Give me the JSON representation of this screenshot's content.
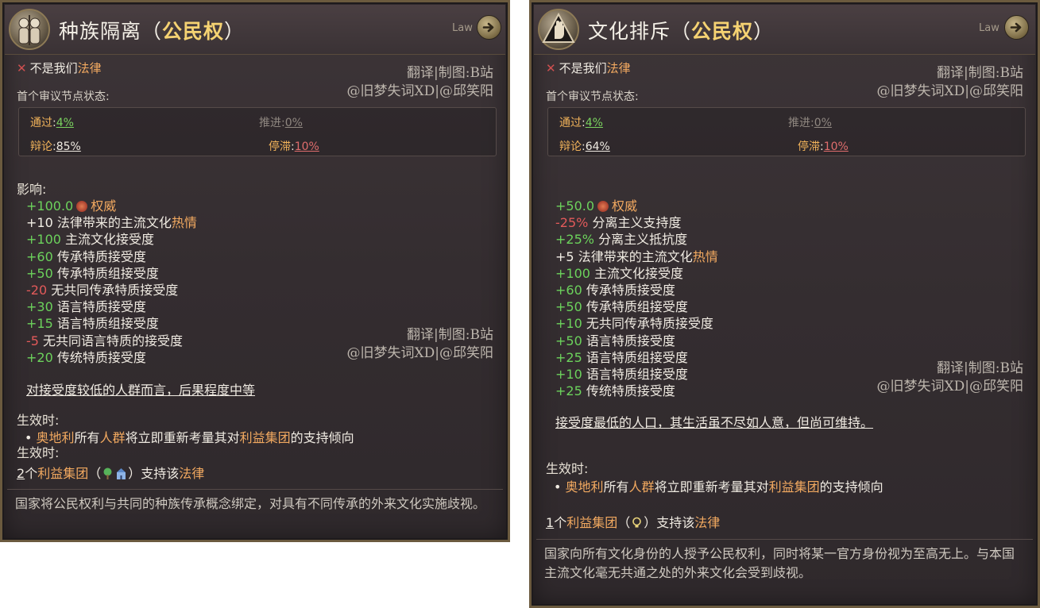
{
  "left": {
    "title_main": "种族隔离",
    "title_open": "（",
    "title_kw": "公民权",
    "title_close": "）",
    "law_tag": "Law",
    "not_law_prefix": "不是我们",
    "not_law_kw": "法律",
    "watermark_1": "翻译|制图:B站",
    "watermark_2": "@旧梦失词XD|@邱笑阳",
    "stage_label": "首个审议节点状态:",
    "stages": {
      "pass_name": "通过",
      "pass_val": "4%",
      "advance_name": "推进",
      "advance_val": "0%",
      "debate_name": "辩论",
      "debate_val": "85%",
      "stall_name": "停滞",
      "stall_val": "10%"
    },
    "effects_title": "影响:",
    "effects": [
      {
        "value": "+100.0",
        "text": "权威",
        "kind": "auth"
      },
      {
        "value": "+10",
        "text": "法律带来的主流文化",
        "extra": "热情",
        "kind": "white"
      },
      {
        "value": "+100",
        "text": "主流文化接受度",
        "kind": "pos"
      },
      {
        "value": "+60",
        "text": "传承特质接受度",
        "kind": "pos"
      },
      {
        "value": "+50",
        "text": "传承特质组接受度",
        "kind": "pos"
      },
      {
        "value": "-20",
        "text": "无共同传承特质接受度",
        "kind": "neg"
      },
      {
        "value": "+30",
        "text": "语言特质接受度",
        "kind": "pos"
      },
      {
        "value": "+15",
        "text": "语言特质组接受度",
        "kind": "pos"
      },
      {
        "value": "-5",
        "text": "无共同语言特质的接受度",
        "kind": "neg"
      },
      {
        "value": "+20",
        "text": "传统特质接受度",
        "kind": "pos"
      }
    ],
    "summary": "对接受度较低的人群而言，后果程度中等",
    "on_enact_title": "生效时:",
    "bullet_country": "奥地利",
    "bullet_mid1": "所有",
    "bullet_pops": "人群",
    "bullet_mid2": "将立即重新考量其对",
    "bullet_ig": "利益集团",
    "bullet_end": "的支持倾向",
    "on_enact_title2": "生效时:",
    "support_count": "2",
    "support_mid": "个",
    "support_ig": "利益集团",
    "support_open": "（",
    "support_close": "）支持该",
    "support_law": "法律",
    "footer": "国家将公民权利与共同的种族传承概念绑定，对具有不同传承的外来文化实施歧视。"
  },
  "right": {
    "title_main": "文化排斥",
    "title_open": "（",
    "title_kw": "公民权",
    "title_close": "）",
    "law_tag": "Law",
    "not_law_prefix": "不是我们",
    "not_law_kw": "法律",
    "watermark_1": "翻译|制图:B站",
    "watermark_2": "@旧梦失词XD|@邱笑阳",
    "stage_label": "首个审议节点状态:",
    "stages": {
      "pass_name": "通过",
      "pass_val": "4%",
      "advance_name": "推进",
      "advance_val": "0%",
      "debate_name": "辩论",
      "debate_val": "64%",
      "stall_name": "停滞",
      "stall_val": "10%"
    },
    "effects": [
      {
        "value": "+50.0",
        "text": "权威",
        "kind": "auth"
      },
      {
        "value": "-25%",
        "text": "分离主义支持度",
        "kind": "neg"
      },
      {
        "value": "+25%",
        "text": "分离主义抵抗度",
        "kind": "pos"
      },
      {
        "value": "+5",
        "text": "法律带来的主流文化",
        "extra": "热情",
        "kind": "white"
      },
      {
        "value": "+100",
        "text": "主流文化接受度",
        "kind": "pos"
      },
      {
        "value": "+60",
        "text": "传承特质接受度",
        "kind": "pos"
      },
      {
        "value": "+50",
        "text": "传承特质组接受度",
        "kind": "pos"
      },
      {
        "value": "+10",
        "text": "无共同传承特质接受度",
        "kind": "pos"
      },
      {
        "value": "+50",
        "text": "语言特质接受度",
        "kind": "pos"
      },
      {
        "value": "+25",
        "text": "语言特质组接受度",
        "kind": "pos"
      },
      {
        "value": "+10",
        "text": "语言特质组接受度",
        "kind": "pos"
      },
      {
        "value": "+25",
        "text": "传统特质接受度",
        "kind": "pos"
      }
    ],
    "watermark_3": "翻译|制图:B站",
    "watermark_4": "@旧梦失词XD|@邱笑阳",
    "summary": "接受度最低的人口，其生活虽不尽如人意，但尚可维持。",
    "on_enact_title": "生效时:",
    "bullet_country": "奥地利",
    "bullet_mid1": "所有",
    "bullet_pops": "人群",
    "bullet_mid2": "将立即重新考量其对",
    "bullet_ig": "利益集团",
    "bullet_end": "的支持倾向",
    "support_count": "1",
    "support_mid": "个",
    "support_ig": "利益集团",
    "support_open": "（",
    "support_close": "）支持该",
    "support_law": "法律",
    "footer": "国家向所有文化身份的人授予公民权利，同时将某一官方身份视为至高无上。与本国主流文化毫无共通之处的外来文化会受到歧视。"
  },
  "colors": {
    "positive": "#6cd25c",
    "negative": "#e25a5a",
    "highlight": "#f2a960",
    "title_keyword": "#f5d272"
  },
  "icons": {
    "left_emblem": "two-figures-emblem",
    "right_emblem": "raised-hand-emblem",
    "law_button": "arrow-right-icon",
    "authority": "authority-icon",
    "not_law": "x-icon"
  }
}
